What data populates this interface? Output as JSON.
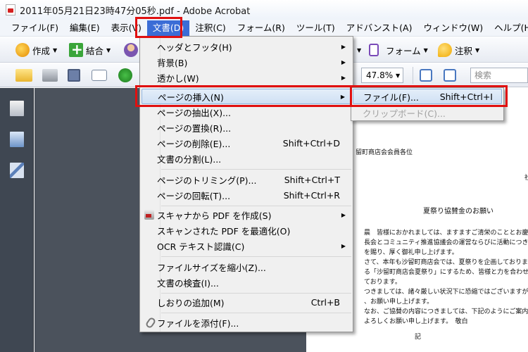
{
  "window": {
    "title": "2011年05月21日23時47分05秒.pdf - Adobe Acrobat"
  },
  "menubar": {
    "items": [
      {
        "label": "ファイル(F)"
      },
      {
        "label": "編集(E)"
      },
      {
        "label": "表示(V)"
      },
      {
        "label": "文書(D)"
      },
      {
        "label": "注釈(C)"
      },
      {
        "label": "フォーム(R)"
      },
      {
        "label": "ツール(T)"
      },
      {
        "label": "アドバンスト(A)"
      },
      {
        "label": "ウィンドウ(W)"
      },
      {
        "label": "ヘルプ(H)"
      }
    ],
    "active_index": 3
  },
  "toolbar": {
    "create_label": "作成",
    "combine_label": "結合",
    "form_label": "フォーム",
    "comment_label": "注釈",
    "zoom_value": "47.8%",
    "search_placeholder": "検索"
  },
  "document_menu": {
    "items": [
      {
        "label": "ヘッダとフッタ(H)",
        "shortcut": "",
        "submenu": true
      },
      {
        "label": "背景(B)",
        "shortcut": "",
        "submenu": true
      },
      {
        "label": "透かし(W)",
        "shortcut": "",
        "submenu": true
      },
      {
        "label": "ページの挿入(N)",
        "shortcut": "",
        "submenu": true
      },
      {
        "label": "ページの抽出(X)...",
        "shortcut": ""
      },
      {
        "label": "ページの置換(R)...",
        "shortcut": ""
      },
      {
        "label": "ページの削除(E)...",
        "shortcut": "Shift+Ctrl+D"
      },
      {
        "label": "文書の分割(L)...",
        "shortcut": ""
      },
      {
        "label": "ページのトリミング(P)...",
        "shortcut": "Shift+Ctrl+T"
      },
      {
        "label": "ページの回転(T)...",
        "shortcut": "Shift+Ctrl+R"
      },
      {
        "label": "スキャナから PDF を作成(S)",
        "shortcut": "",
        "submenu": true
      },
      {
        "label": "スキャンされた PDF を最適化(O)",
        "shortcut": ""
      },
      {
        "label": "OCR テキスト認識(C)",
        "shortcut": "",
        "submenu": true
      },
      {
        "label": "ファイルサイズを縮小(Z)...",
        "shortcut": ""
      },
      {
        "label": "文書の検査(I)...",
        "shortcut": ""
      },
      {
        "label": "しおりの追加(M)",
        "shortcut": "Ctrl+B"
      },
      {
        "label": "ファイルを添付(F)...",
        "shortcut": ""
      }
    ]
  },
  "insert_submenu": {
    "items": [
      {
        "label": "ファイル(F)...",
        "shortcut": "Shift+Ctrl+I"
      },
      {
        "label": "クリップボード(C)...",
        "shortcut": ""
      }
    ]
  },
  "pdf_page": {
    "addressee": "留町商店会会員各位",
    "side_mark": "社",
    "heading": "夏祭り協賛金のお願い",
    "body_lines": [
      "晨　皆様におかれましては、ますますご清栄のこととお慶び申し上げま",
      "長会とコミュニティ推進協議会の運営ならびに活動につきまして、格別",
      "を賜り、厚く御礼申し上げます。",
      "さて、本年も沙留町商店会では、夏祭りを企画しております。大勢にご",
      "る「沙留町商店会夏祭り」にするため、皆様と力を合わせて取り組んで",
      "ております。",
      "つきましては、諸々厳しい状況下に恐縮ではございますが、皆様からの",
      "、お願い申し上げます。",
      "なお、ご協賛の内容につきましては、下記のようにご案内させていただ",
      "よろしくお願い申し上げます。　敬白"
    ],
    "ki": "記"
  },
  "colors": {
    "highlight": "#e01010",
    "menu_active": "#3b6dd6",
    "workspace": "#4b525c"
  }
}
